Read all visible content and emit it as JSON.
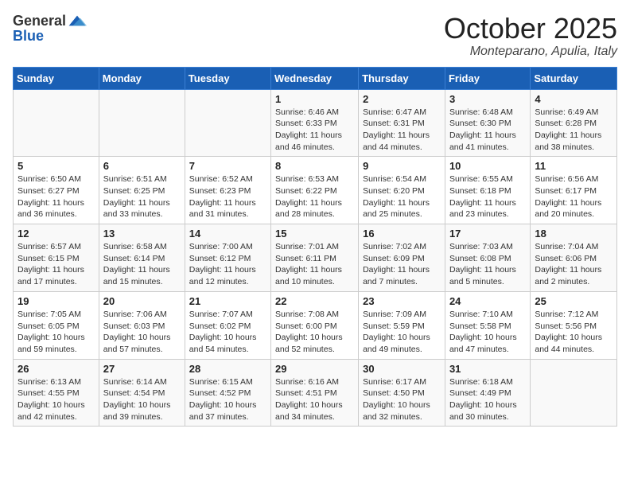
{
  "header": {
    "logo": {
      "text_general": "General",
      "text_blue": "Blue",
      "icon_title": "GeneralBlue logo"
    },
    "title": "October 2025",
    "location": "Monteparano, Apulia, Italy"
  },
  "weekdays": [
    "Sunday",
    "Monday",
    "Tuesday",
    "Wednesday",
    "Thursday",
    "Friday",
    "Saturday"
  ],
  "weeks": [
    [
      {
        "day": "",
        "info": ""
      },
      {
        "day": "",
        "info": ""
      },
      {
        "day": "",
        "info": ""
      },
      {
        "day": "1",
        "info": "Sunrise: 6:46 AM\nSunset: 6:33 PM\nDaylight: 11 hours\nand 46 minutes."
      },
      {
        "day": "2",
        "info": "Sunrise: 6:47 AM\nSunset: 6:31 PM\nDaylight: 11 hours\nand 44 minutes."
      },
      {
        "day": "3",
        "info": "Sunrise: 6:48 AM\nSunset: 6:30 PM\nDaylight: 11 hours\nand 41 minutes."
      },
      {
        "day": "4",
        "info": "Sunrise: 6:49 AM\nSunset: 6:28 PM\nDaylight: 11 hours\nand 38 minutes."
      }
    ],
    [
      {
        "day": "5",
        "info": "Sunrise: 6:50 AM\nSunset: 6:27 PM\nDaylight: 11 hours\nand 36 minutes."
      },
      {
        "day": "6",
        "info": "Sunrise: 6:51 AM\nSunset: 6:25 PM\nDaylight: 11 hours\nand 33 minutes."
      },
      {
        "day": "7",
        "info": "Sunrise: 6:52 AM\nSunset: 6:23 PM\nDaylight: 11 hours\nand 31 minutes."
      },
      {
        "day": "8",
        "info": "Sunrise: 6:53 AM\nSunset: 6:22 PM\nDaylight: 11 hours\nand 28 minutes."
      },
      {
        "day": "9",
        "info": "Sunrise: 6:54 AM\nSunset: 6:20 PM\nDaylight: 11 hours\nand 25 minutes."
      },
      {
        "day": "10",
        "info": "Sunrise: 6:55 AM\nSunset: 6:18 PM\nDaylight: 11 hours\nand 23 minutes."
      },
      {
        "day": "11",
        "info": "Sunrise: 6:56 AM\nSunset: 6:17 PM\nDaylight: 11 hours\nand 20 minutes."
      }
    ],
    [
      {
        "day": "12",
        "info": "Sunrise: 6:57 AM\nSunset: 6:15 PM\nDaylight: 11 hours\nand 17 minutes."
      },
      {
        "day": "13",
        "info": "Sunrise: 6:58 AM\nSunset: 6:14 PM\nDaylight: 11 hours\nand 15 minutes."
      },
      {
        "day": "14",
        "info": "Sunrise: 7:00 AM\nSunset: 6:12 PM\nDaylight: 11 hours\nand 12 minutes."
      },
      {
        "day": "15",
        "info": "Sunrise: 7:01 AM\nSunset: 6:11 PM\nDaylight: 11 hours\nand 10 minutes."
      },
      {
        "day": "16",
        "info": "Sunrise: 7:02 AM\nSunset: 6:09 PM\nDaylight: 11 hours\nand 7 minutes."
      },
      {
        "day": "17",
        "info": "Sunrise: 7:03 AM\nSunset: 6:08 PM\nDaylight: 11 hours\nand 5 minutes."
      },
      {
        "day": "18",
        "info": "Sunrise: 7:04 AM\nSunset: 6:06 PM\nDaylight: 11 hours\nand 2 minutes."
      }
    ],
    [
      {
        "day": "19",
        "info": "Sunrise: 7:05 AM\nSunset: 6:05 PM\nDaylight: 10 hours\nand 59 minutes."
      },
      {
        "day": "20",
        "info": "Sunrise: 7:06 AM\nSunset: 6:03 PM\nDaylight: 10 hours\nand 57 minutes."
      },
      {
        "day": "21",
        "info": "Sunrise: 7:07 AM\nSunset: 6:02 PM\nDaylight: 10 hours\nand 54 minutes."
      },
      {
        "day": "22",
        "info": "Sunrise: 7:08 AM\nSunset: 6:00 PM\nDaylight: 10 hours\nand 52 minutes."
      },
      {
        "day": "23",
        "info": "Sunrise: 7:09 AM\nSunset: 5:59 PM\nDaylight: 10 hours\nand 49 minutes."
      },
      {
        "day": "24",
        "info": "Sunrise: 7:10 AM\nSunset: 5:58 PM\nDaylight: 10 hours\nand 47 minutes."
      },
      {
        "day": "25",
        "info": "Sunrise: 7:12 AM\nSunset: 5:56 PM\nDaylight: 10 hours\nand 44 minutes."
      }
    ],
    [
      {
        "day": "26",
        "info": "Sunrise: 6:13 AM\nSunset: 4:55 PM\nDaylight: 10 hours\nand 42 minutes."
      },
      {
        "day": "27",
        "info": "Sunrise: 6:14 AM\nSunset: 4:54 PM\nDaylight: 10 hours\nand 39 minutes."
      },
      {
        "day": "28",
        "info": "Sunrise: 6:15 AM\nSunset: 4:52 PM\nDaylight: 10 hours\nand 37 minutes."
      },
      {
        "day": "29",
        "info": "Sunrise: 6:16 AM\nSunset: 4:51 PM\nDaylight: 10 hours\nand 34 minutes."
      },
      {
        "day": "30",
        "info": "Sunrise: 6:17 AM\nSunset: 4:50 PM\nDaylight: 10 hours\nand 32 minutes."
      },
      {
        "day": "31",
        "info": "Sunrise: 6:18 AM\nSunset: 4:49 PM\nDaylight: 10 hours\nand 30 minutes."
      },
      {
        "day": "",
        "info": ""
      }
    ]
  ]
}
